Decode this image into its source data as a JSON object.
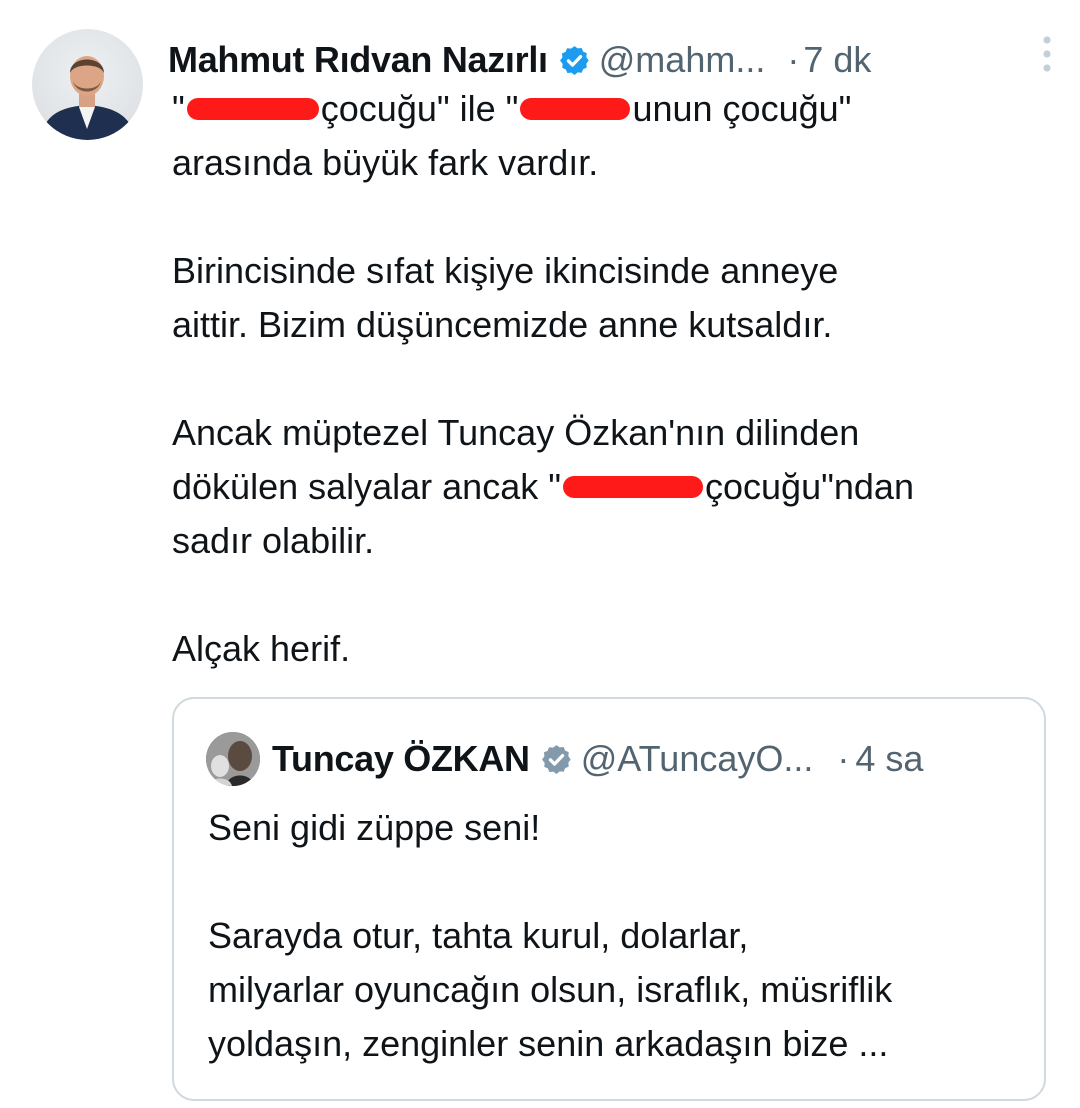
{
  "tweet": {
    "author_name": "Mahmut Rıdvan Nazırlı",
    "author_handle": "@mahm...",
    "dot": "·",
    "time": "7 dk",
    "line1": {
      "q1": "\"",
      "t1": "çocuğu\" ile \"",
      "t2": "unun çocuğu\""
    },
    "line2": "arasında büyük fark vardır.",
    "p2a": "Birincisinde sıfat kişiye ikincisinde anneye",
    "p2b": "aittir. Bizim düşüncemizde anne kutsaldır.",
    "p3a": "Ancak müptezel Tuncay Özkan'nın dilinden",
    "p3b_pre": "dökülen salyalar ancak \"",
    "p3b_post": "çocuğu\"ndan",
    "p3c": "sadır olabilir.",
    "p4": "Alçak herif."
  },
  "quote": {
    "author_name": "Tuncay ÖZKAN",
    "author_handle": "@ATuncayO...",
    "dot": "·",
    "time": "4 sa",
    "p1": "Seni gidi züppe seni!",
    "p2a": "Sarayda otur, tahta kurul, dolarlar,",
    "p2b": "milyarlar oyuncağın olsun, israflık, müsriflik",
    "p2c": "yoldaşın, zenginler senin arkadaşın bize ..."
  },
  "icons": {
    "verified": "verified-badge-icon",
    "more": "more-options-icon"
  },
  "colors": {
    "verified_blue": "#1d9bf0",
    "quote_verified_gray": "#829aab",
    "redaction_red": "#ff1a1a",
    "muted": "#536471"
  }
}
